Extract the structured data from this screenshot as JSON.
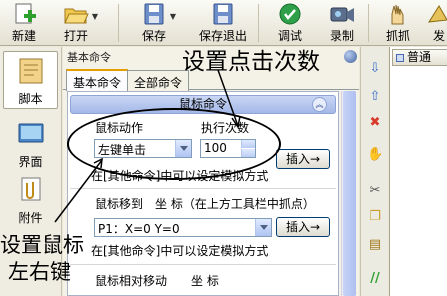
{
  "toolbar": {
    "items": [
      {
        "label": "新建",
        "icon": "new-file-icon"
      },
      {
        "label": "打开",
        "icon": "open-folder-icon"
      },
      {
        "label": "保存",
        "icon": "save-icon"
      },
      {
        "label": "保存退出",
        "icon": "save-exit-icon"
      },
      {
        "label": "调试",
        "icon": "debug-icon"
      },
      {
        "label": "录制",
        "icon": "record-icon"
      },
      {
        "label": "抓抓",
        "icon": "grab-icon"
      },
      {
        "label": "发",
        "icon": "publish-icon"
      }
    ]
  },
  "leftnav": {
    "items": [
      {
        "label": "脚本",
        "icon": "script-icon",
        "active": true
      },
      {
        "label": "界面",
        "icon": "interface-icon",
        "active": false
      },
      {
        "label": "附件",
        "icon": "attachment-icon",
        "active": false
      }
    ]
  },
  "panel": {
    "title": "基本命令",
    "tabs": [
      "基本命令",
      "全部命令"
    ],
    "active_tab": 0,
    "section_title": "鼠标命令",
    "mouse_action_label": "鼠标动作",
    "mouse_action_value": "左键单击",
    "exec_count_label": "执行次数",
    "exec_count_value": "100",
    "insert_label": "插入→",
    "hint": "在[其他命令]中可以设定模拟方式",
    "move_label": "鼠标移到　坐 标（在上方工具栏中抓点）",
    "coord_value": "P1：X=0 Y=0",
    "relative_label": "鼠标相对移动　　坐 标"
  },
  "annotations": {
    "click_count": "设置点击次数",
    "mouse_button_line1": "设置鼠标",
    "mouse_button_line2": "左右键"
  },
  "right_pane": {
    "tab": "普通"
  },
  "colors": {
    "section_header": "#a4b8e8",
    "tab_highlight": "#e5a000",
    "window_bg": "#ece9d8"
  }
}
